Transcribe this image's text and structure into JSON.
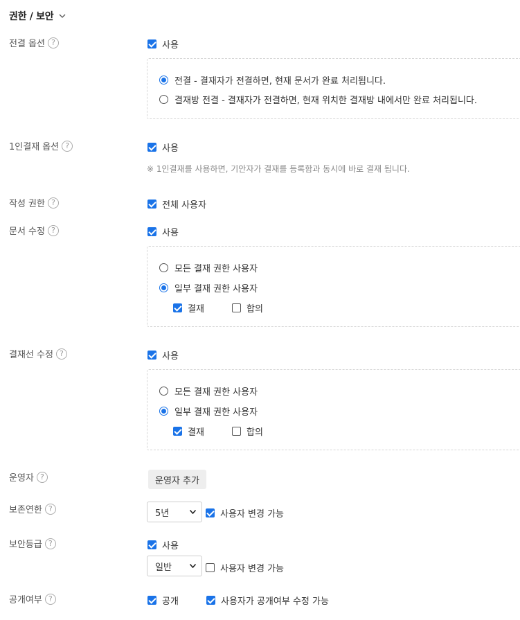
{
  "section": {
    "title": "권한 / 보안",
    "chevron": "chevron-down-icon"
  },
  "help_glyph": "?",
  "rows": {
    "approval_option": {
      "label": "전결 옵션",
      "use": {
        "label": "사용",
        "checked": true
      },
      "radios": [
        {
          "label": "전결 - 결재자가 전결하면, 현재 문서가 완료 처리됩니다.",
          "selected": true
        },
        {
          "label": "결재방 전결 - 결재자가 전결하면, 현재 위치한 결재방 내에서만 완료 처리됩니다.",
          "selected": false
        }
      ]
    },
    "single_approval": {
      "label": "1인결재 옵션",
      "use": {
        "label": "사용",
        "checked": true
      },
      "note": "※ 1인결재를 사용하면, 기안자가 결재를 등록함과 동시에 바로 결재 됩니다."
    },
    "write_permission": {
      "label": "작성 권한",
      "option": {
        "label": "전체 사용자",
        "checked": true
      }
    },
    "doc_edit": {
      "label": "문서 수정",
      "use": {
        "label": "사용",
        "checked": true
      },
      "radios": [
        {
          "label": "모든 결재 권한 사용자",
          "selected": false
        },
        {
          "label": "일부 결재 권한 사용자",
          "selected": true
        }
      ],
      "sub": [
        {
          "label": "결재",
          "checked": true
        },
        {
          "label": "합의",
          "checked": false
        }
      ]
    },
    "line_edit": {
      "label": "결재선 수정",
      "use": {
        "label": "사용",
        "checked": true
      },
      "radios": [
        {
          "label": "모든 결재 권한 사용자",
          "selected": false
        },
        {
          "label": "일부 결재 권한 사용자",
          "selected": true
        }
      ],
      "sub": [
        {
          "label": "결재",
          "checked": true
        },
        {
          "label": "합의",
          "checked": false
        }
      ]
    },
    "operator": {
      "label": "운영자",
      "button": "운영자 추가"
    },
    "retention": {
      "label": "보존연한",
      "select_value": "5년",
      "user_change": {
        "label": "사용자 변경 가능",
        "checked": true
      }
    },
    "security_level": {
      "label": "보안등급",
      "use": {
        "label": "사용",
        "checked": true
      },
      "select_value": "일반",
      "user_change": {
        "label": "사용자 변경 가능",
        "checked": false
      }
    },
    "public": {
      "label": "공개여부",
      "public_option": {
        "label": "공개",
        "checked": true
      },
      "user_edit": {
        "label": "사용자가 공개여부 수정 가능",
        "checked": true
      }
    }
  },
  "colors": {
    "accent": "#1a73e8",
    "label": "#555555",
    "note": "#888888",
    "dashed": "#d5d5d5"
  }
}
